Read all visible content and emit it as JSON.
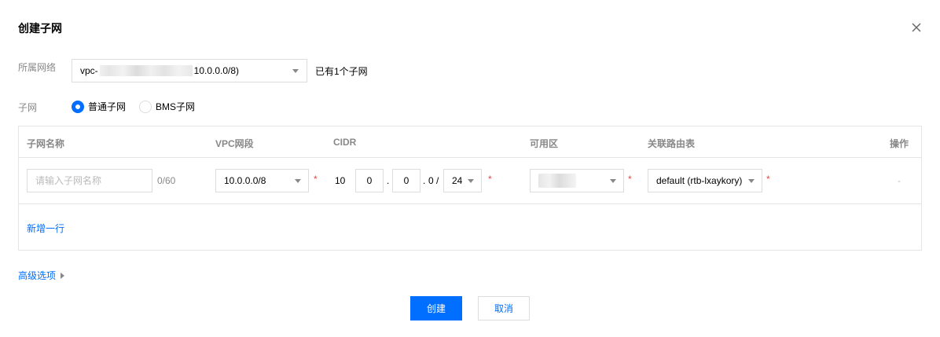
{
  "dialog": {
    "title": "创建子网",
    "close_icon": "close-icon"
  },
  "vpc": {
    "label": "所属网络",
    "select_prefix": "vpc-",
    "select_suffix": "10.0.0.0/8)",
    "hint": "已有1个子网"
  },
  "subnet_type": {
    "label": "子网",
    "options": [
      {
        "label": "普通子网",
        "checked": true
      },
      {
        "label": "BMS子网",
        "checked": false
      }
    ]
  },
  "table": {
    "headers": {
      "name": "子网名称",
      "vpc_cidr": "VPC网段",
      "cidr": "CIDR",
      "zone": "可用区",
      "route_table": "关联路由表",
      "action": "操作"
    },
    "row": {
      "name_placeholder": "请输入子网名称",
      "char_count": "0/60",
      "vpc_cidr_value": "10.0.0.0/8",
      "cidr_prefix": "10",
      "cidr_octet2": "0",
      "cidr_octet3": "0",
      "cidr_octet4": "0 /",
      "cidr_mask": "24",
      "route_table_value": "default (rtb-lxaykory)",
      "action_value": "-",
      "required_mark": "*"
    },
    "add_row": "新增一行"
  },
  "advanced": {
    "label": "高级选项"
  },
  "buttons": {
    "create": "创建",
    "cancel": "取消"
  },
  "colors": {
    "primary": "#006eff",
    "required": "#e54545",
    "label": "#888888",
    "border": "#dddddd"
  }
}
